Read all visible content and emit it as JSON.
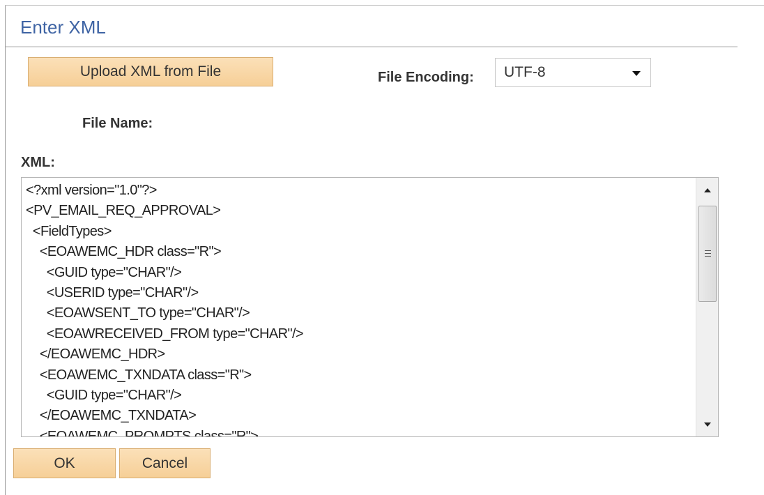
{
  "dialog": {
    "title": "Enter XML"
  },
  "upload": {
    "button_label": "Upload XML from File"
  },
  "encoding": {
    "label": "File Encoding:",
    "selected": "UTF-8"
  },
  "file": {
    "label": "File Name:"
  },
  "xml": {
    "label": "XML:",
    "lines": [
      "<?xml version=\"1.0\"?>",
      "<PV_EMAIL_REQ_APPROVAL>",
      "  <FieldTypes>",
      "    <EOAWEMC_HDR class=\"R\">",
      "      <GUID type=\"CHAR\"/>",
      "      <USERID type=\"CHAR\"/>",
      "      <EOAWSENT_TO type=\"CHAR\"/>",
      "      <EOAWRECEIVED_FROM type=\"CHAR\"/>",
      "    </EOAWEMC_HDR>",
      "    <EOAWEMC_TXNDATA class=\"R\">",
      "      <GUID type=\"CHAR\"/>",
      "    </EOAWEMC_TXNDATA>",
      "    <EOAWEMC_PROMPTS class=\"R\">"
    ]
  },
  "actions": {
    "ok_label": "OK",
    "cancel_label": "Cancel"
  },
  "icons": {
    "dropdown": "chevron-down-icon",
    "scroll_up": "scroll-up-arrow-icon",
    "scroll_down": "scroll-down-arrow-icon",
    "scroll_grip": "grip-icon"
  },
  "colors": {
    "title": "#3f64a4",
    "button_fill": "#f6cf97",
    "button_border": "#d9ad70"
  }
}
